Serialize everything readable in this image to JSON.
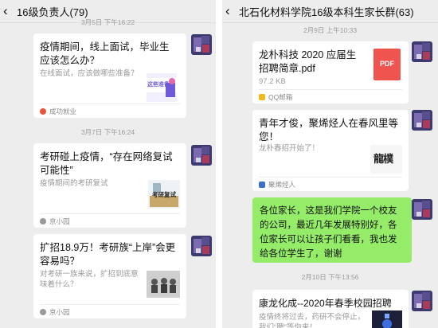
{
  "left": {
    "title": "16级负责人(79)",
    "timestamps": [
      "3月5日 下午16:22",
      "3月7日 下午16:24"
    ],
    "cards": [
      {
        "title": "疫情期间，线上面试，毕业生应该怎么办？",
        "desc": "在线面试，应该做哪些准备？",
        "thumb_text": "这些准备",
        "source": "成功就业"
      },
      {
        "title": "考研碰上疫情，“存在网络复试可能性”",
        "desc": "疫情期间的考研复试",
        "thumb_text": "考研复试",
        "source": "京小园"
      },
      {
        "title": "扩招18.9万！考研族“上岸”会更容易吗？",
        "desc": "对考研一族来说，扩招到底意味着什么？",
        "source": "京小园"
      }
    ]
  },
  "right": {
    "title": "北石化材料学院16级本科生家长群(63)",
    "timestamps": [
      "2月9日 上午10:33",
      "2月10日 下午13:56"
    ],
    "file": {
      "name": "龙朴科技 2020 应届生招聘简章.pdf",
      "size": "97.2 KB",
      "badge": "PDF",
      "source": "QQ邮箱"
    },
    "article": {
      "title": "青年才俊，聚烯烃人在春风里等您！",
      "desc": "龙朴春招开始了！",
      "thumb_text": "龍樸",
      "source": "聚烯烃人"
    },
    "message": "各位家长，这是我们学院一个校友的公司，最近几年发展特别好，各位家长可以让孩子们看看，我也发给各位学生了，谢谢",
    "last_card": {
      "title": "康龙化成--2020年春季校园招聘",
      "desc": "疫情终将过去，药研不会停止，我们“聘”等你来！"
    }
  },
  "colors": {
    "bubble": "#95ec69",
    "pdf_badge": "#f0544f",
    "background": "#ededed"
  }
}
